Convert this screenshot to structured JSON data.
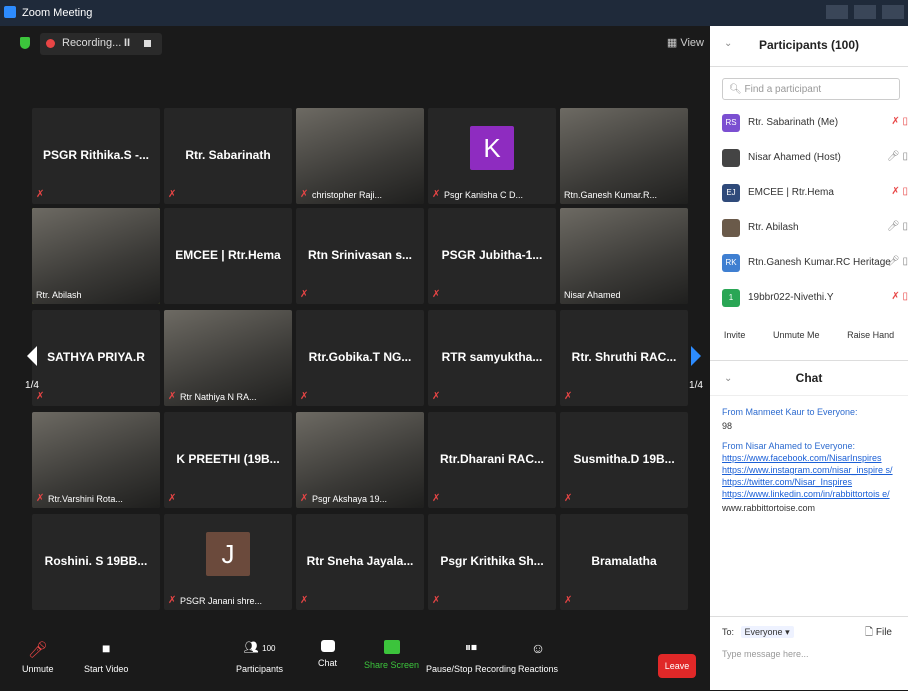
{
  "window": {
    "title": "Zoom Meeting"
  },
  "topbar": {
    "recording": "Recording...",
    "pause": "II",
    "view": "View"
  },
  "pager": {
    "left": "1/4",
    "right": "1/4"
  },
  "tiles": [
    {
      "name": "PSGR Rithika.S -...",
      "label": "",
      "muted": true
    },
    {
      "name": "Rtr. Sabarinath",
      "label": "",
      "muted": true
    },
    {
      "name": "",
      "label": "christopher Raji...",
      "muted": true,
      "photo": true
    },
    {
      "name": "",
      "label": "Psgr Kanisha C D...",
      "muted": true,
      "avatar": "K",
      "avatarColor": "#8e2cc0"
    },
    {
      "name": "",
      "label": "Rtn.Ganesh Kumar.R...",
      "muted": false,
      "photo": true
    },
    {
      "name": "",
      "label": "Rtr. Abilash",
      "muted": false,
      "photo": true,
      "active": true
    },
    {
      "name": "EMCEE | Rtr.Hema",
      "label": "",
      "muted": false
    },
    {
      "name": "Rtn Srinivasan s...",
      "label": "",
      "muted": true
    },
    {
      "name": "PSGR Jubitha-1...",
      "label": "",
      "muted": true
    },
    {
      "name": "",
      "label": "Nisar Ahamed",
      "muted": false,
      "photo": true
    },
    {
      "name": "SATHYA PRIYA.R",
      "label": "",
      "muted": true
    },
    {
      "name": "",
      "label": "Rtr Nathiya N RA...",
      "muted": true,
      "photo": true
    },
    {
      "name": "Rtr.Gobika.T NG...",
      "label": "",
      "muted": true
    },
    {
      "name": "RTR samyuktha...",
      "label": "",
      "muted": true
    },
    {
      "name": "Rtr. Shruthi RAC...",
      "label": "",
      "muted": true
    },
    {
      "name": "",
      "label": "Rtr.Varshini Rota...",
      "muted": true,
      "photo": true
    },
    {
      "name": "K PREETHI (19B...",
      "label": "",
      "muted": true
    },
    {
      "name": "",
      "label": "Psgr Akshaya 19...",
      "muted": true,
      "photo": true
    },
    {
      "name": "Rtr.Dharani RAC...",
      "label": "",
      "muted": true
    },
    {
      "name": "Susmitha.D 19B...",
      "label": "",
      "muted": true
    },
    {
      "name": "Roshini. S 19BB...",
      "label": "",
      "muted": false
    },
    {
      "name": "",
      "label": "PSGR Janani shre...",
      "muted": true,
      "avatar": "J",
      "avatarColor": "#6b4a3c"
    },
    {
      "name": "Rtr Sneha Jayala...",
      "label": "",
      "muted": true
    },
    {
      "name": "Psgr Krithika Sh...",
      "label": "",
      "muted": true
    },
    {
      "name": "Bramalatha",
      "label": "",
      "muted": true
    }
  ],
  "toolbar": {
    "unmute": "Unmute",
    "video": "Start Video",
    "participants": "Participants",
    "participants_count": "100",
    "chat": "Chat",
    "share": "Share Screen",
    "record": "Pause/Stop Recording",
    "reactions": "Reactions",
    "leave": "Leave"
  },
  "panel": {
    "title": "Participants (100)",
    "search_placeholder": "Find a participant",
    "participants": [
      {
        "initials": "RS",
        "color": "#7b4fd1",
        "name": "Rtr. Sabarinath (Me)"
      },
      {
        "initials": "",
        "color": "#444",
        "name": "Nisar Ahamed (Host)"
      },
      {
        "initials": "EJ",
        "color": "#2f4a7a",
        "name": "EMCEE | Rtr.Hema"
      },
      {
        "initials": "",
        "color": "#6a5a4a",
        "name": "Rtr. Abilash"
      },
      {
        "initials": "RK",
        "color": "#3f7fd1",
        "name": "Rtn.Ganesh Kumar.RC Heritage"
      },
      {
        "initials": "1",
        "color": "#2aa655",
        "name": "19bbr022-Nivethi.Y"
      }
    ],
    "buttons": {
      "invite": "Invite",
      "unmute_me": "Unmute Me",
      "raise_hand": "Raise Hand"
    }
  },
  "chat": {
    "title": "Chat",
    "messages": [
      {
        "from": "From Manmeet Kaur to Everyone:",
        "text": "98"
      },
      {
        "from": "From Nisar Ahamed to Everyone:",
        "links": [
          "https://www.facebook.com/NisarInspires",
          "https://www.instagram.com/nisar_inspire s/",
          "https://twitter.com/Nisar_Inspires",
          "https://www.linkedin.com/in/rabbittortois e/"
        ],
        "text": "www.rabbittortoise.com"
      }
    ],
    "to_label": "To:",
    "to_value": "Everyone",
    "file": "File",
    "placeholder": "Type message here..."
  }
}
